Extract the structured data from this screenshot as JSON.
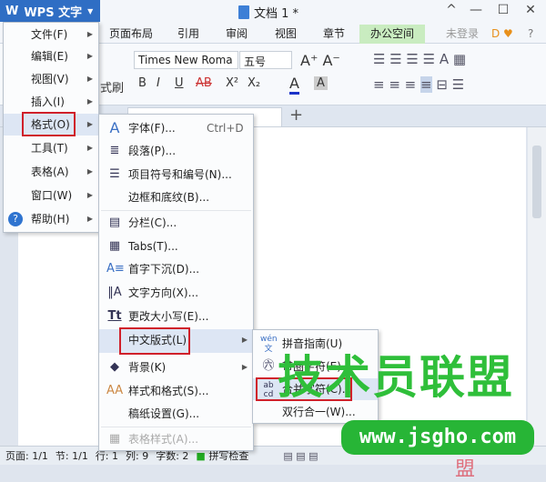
{
  "app": {
    "name": "WPS 文字",
    "doc_title": "文档 1 *"
  },
  "window_controls": [
    "^",
    "—",
    "☐",
    "✕"
  ],
  "menu_tabs": [
    "页面布局",
    "引用",
    "审阅",
    "视图",
    "章节",
    "办公空间"
  ],
  "account": {
    "login": "未登录",
    "help": "?"
  },
  "ribbon": {
    "format_painter": "式刷",
    "font": "Times New Roma",
    "size": "五号",
    "buttons": [
      "B",
      "I",
      "U",
      "AB",
      "X²",
      "X₂",
      "A",
      "A"
    ]
  },
  "main_menu": [
    {
      "label": "文件(F)"
    },
    {
      "label": "编辑(E)"
    },
    {
      "label": "视图(V)"
    },
    {
      "label": "插入(I)"
    },
    {
      "label": "格式(O)",
      "active": true
    },
    {
      "label": "工具(T)"
    },
    {
      "label": "表格(A)"
    },
    {
      "label": "窗口(W)"
    },
    {
      "label": "帮助(H)"
    }
  ],
  "format_menu": [
    {
      "label": "字体(F)...",
      "shortcut": "Ctrl+D",
      "icon": "font-icon"
    },
    {
      "label": "段落(P)...",
      "icon": "paragraph-icon"
    },
    {
      "label": "项目符号和编号(N)...",
      "icon": "bullet-list-icon"
    },
    {
      "label": "边框和底纹(B)..."
    },
    {
      "label": "分栏(C)...",
      "icon": "columns-icon"
    },
    {
      "label": "Tabs(T)...",
      "icon": "tabs-icon"
    },
    {
      "label": "首字下沉(D)...",
      "icon": "drop-cap-icon"
    },
    {
      "label": "文字方向(X)...",
      "icon": "text-direction-icon"
    },
    {
      "label": "更改大小写(E)...",
      "icon": "change-case-icon"
    },
    {
      "label": "中文版式(L)",
      "active": true
    },
    {
      "label": "背景(K)",
      "icon": "background-icon"
    },
    {
      "label": "样式和格式(S)...",
      "icon": "styles-icon"
    },
    {
      "label": "稿纸设置(G)..."
    },
    {
      "label": "表格样式(A)...",
      "disabled": true,
      "icon": "table-style-icon"
    }
  ],
  "chinese_layout_menu": [
    {
      "label": "拼音指南(U)",
      "icon": "pinyin-icon"
    },
    {
      "label": "带圈字符(E)...",
      "icon": "enclosed-char-icon"
    },
    {
      "label": "合并字符(C)...",
      "icon": "combine-chars-icon",
      "active": true
    },
    {
      "label": "双行合一(W)..."
    }
  ],
  "status": {
    "page": "页面: 1/1",
    "section": "节: 1/1",
    "row": "行: 1",
    "col": "列: 9",
    "words": "字数: 2",
    "spell": "拼写检查"
  },
  "watermark": {
    "title": "技术员联盟",
    "url": "www.jsgho.com",
    "faint": "Word联盟"
  },
  "colors": {
    "accent": "#2f6ec4",
    "highlight_box": "#d0202a",
    "menu_hover": "#dde6f4",
    "office_tab": "#c9ecc0"
  }
}
